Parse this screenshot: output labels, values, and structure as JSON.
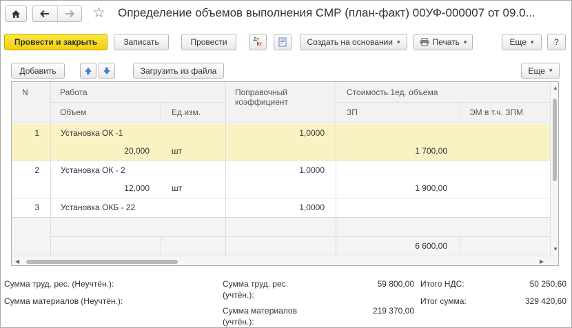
{
  "window": {
    "title": "Определение объемов выполнения СМР (план-факт) 00УФ-000007 от 09.0..."
  },
  "toolbar": {
    "post_close": "Провести и закрыть",
    "save": "Записать",
    "post": "Провести",
    "dtkt_top": "Дт",
    "dtkt_bottom": "Кт",
    "create_based": "Создать на основании",
    "print": "Печать",
    "more": "Еще",
    "help": "?"
  },
  "table_toolbar": {
    "add": "Добавить",
    "load": "Загрузить из файла",
    "more": "Еще"
  },
  "table": {
    "headers": {
      "n": "N",
      "work": "Работа",
      "volume": "Объем",
      "unit": "Ед.изм.",
      "coef": "Поправочный коэффициент",
      "cost": "Стоимость 1ед. объема",
      "zp": "ЗП",
      "em": "ЭМ в т.ч. ЗПМ"
    },
    "rows": [
      {
        "n": "1",
        "work": "Установка ОК -1",
        "coef": "1,0000",
        "volume": "20,000",
        "unit": "шт",
        "zp": "1 700,00"
      },
      {
        "n": "2",
        "work": "Установка ОК - 2",
        "coef": "1,0000",
        "volume": "12,000",
        "unit": "шт",
        "zp": "1 900,00"
      },
      {
        "n": "3",
        "work": "Установка ОКБ - 22",
        "coef": "1,0000"
      }
    ],
    "total_zp": "6 600,00"
  },
  "footer": {
    "labor_unacc_label": "Сумма труд. рес. (Неучтён.):",
    "mat_unacc_label": "Сумма материалов (Неучтён.):",
    "labor_acc_label_1": "Сумма труд. рес.",
    "labor_acc_label_2": "(учтён.):",
    "labor_acc_value": "59 800,00",
    "mat_acc_label_1": "Сумма материалов",
    "mat_acc_label_2": "(учтён.):",
    "mat_acc_value": "219 370,00",
    "vat_label": "Итого НДС:",
    "vat_value": "50 250,60",
    "total_label": "Итог сумма:",
    "total_value": "329 420,60"
  },
  "colors": {
    "primary_button": "#f4cf0f",
    "selected_row": "#fbf2c4",
    "header_bg": "#f2f2f2",
    "arrow_blue": "#3f7fd0"
  }
}
